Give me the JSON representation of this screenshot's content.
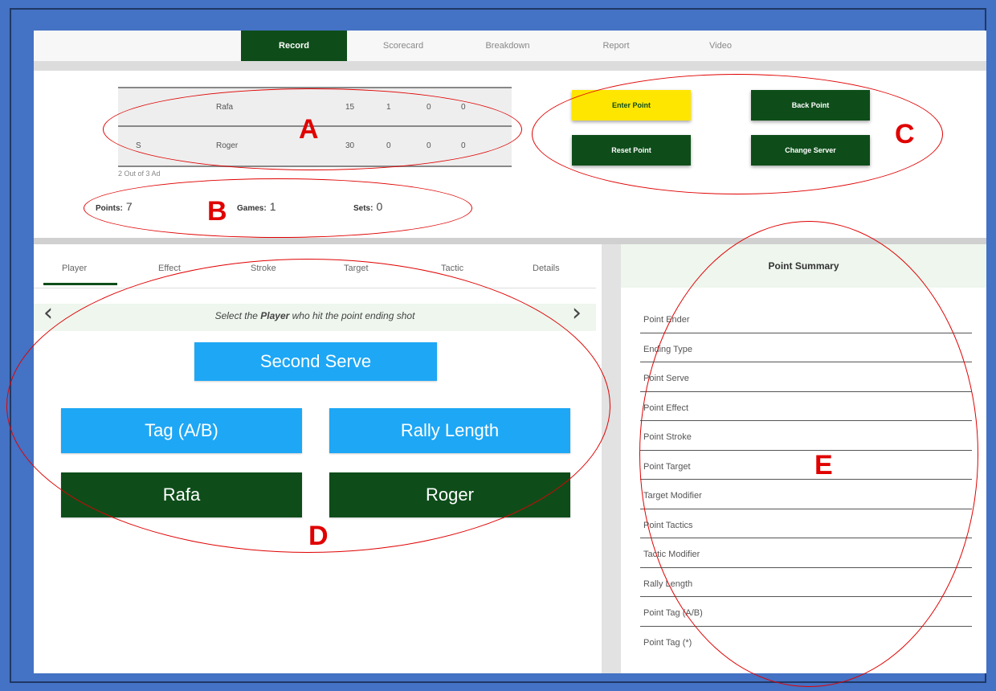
{
  "nav": {
    "tabs": [
      {
        "label": "Record",
        "active": true
      },
      {
        "label": "Scorecard",
        "active": false
      },
      {
        "label": "Breakdown",
        "active": false
      },
      {
        "label": "Report",
        "active": false
      },
      {
        "label": "Video",
        "active": false
      }
    ]
  },
  "scoreboard": {
    "rows": [
      {
        "serve": "",
        "name": "Rafa",
        "points": "15",
        "games": "1",
        "set1": "0",
        "set2": "0"
      },
      {
        "serve": "S",
        "name": "Roger",
        "points": "30",
        "games": "0",
        "set1": "0",
        "set2": "0"
      }
    ],
    "format": "2 Out of 3 Ad"
  },
  "stats": {
    "points_label": "Points:",
    "points_value": "7",
    "games_label": "Games:",
    "games_value": "1",
    "sets_label": "Sets:",
    "sets_value": "0"
  },
  "actions": {
    "enter_point": "Enter Point",
    "back_point": "Back Point",
    "reset_point": "Reset Point",
    "change_server": "Change Server"
  },
  "entry": {
    "tabs": [
      "Player",
      "Effect",
      "Stroke",
      "Target",
      "Tactic",
      "Details"
    ],
    "active_tab": "Player",
    "prompt_pre": "Select the ",
    "prompt_bold": "Player",
    "prompt_post": " who hit the point ending shot",
    "serve_button": "Second Serve",
    "tag_button": "Tag (A/B)",
    "rally_button": "Rally Length",
    "player_a": "Rafa",
    "player_b": "Roger"
  },
  "summary": {
    "title": "Point Summary",
    "items": [
      "Point Ender",
      "Ending Type",
      "Point Serve",
      "Point Effect",
      "Point Stroke",
      "Point Target",
      "Target Modifier",
      "Point Tactics",
      "Tactic Modifier",
      "Rally Length",
      "Point Tag (A/B)",
      "Point Tag (*)"
    ]
  },
  "annotations": {
    "A": "A",
    "B": "B",
    "C": "C",
    "D": "D",
    "E": "E"
  },
  "colors": {
    "brand_green": "#0e4d1a",
    "accent_yellow": "#ffe600",
    "accent_blue": "#1ea7f5",
    "annotation_red": "#e00000",
    "frame_blue": "#4472c4"
  }
}
